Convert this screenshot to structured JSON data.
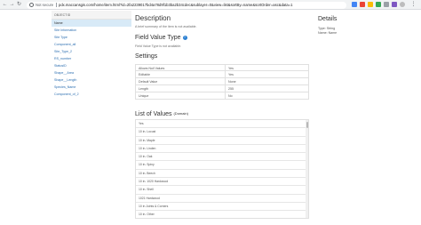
{
  "browser": {
    "security_label": "Not secure",
    "url": "pdx.maccansgis.com/home/item.html?id=2fa2239017bd4a78d9f1b3ba2b34cdec&sublayer=0&view=list&sortBy=name&sortOrder=asc&data=1"
  },
  "sidebar": {
    "header": "OBJECTID",
    "items": [
      {
        "label": "Name"
      },
      {
        "label": "Site Information"
      },
      {
        "label": "Site Type"
      },
      {
        "label": "Component_all"
      },
      {
        "label": "Site_Type_2"
      },
      {
        "label": "RS_number"
      },
      {
        "label": "StatusID"
      },
      {
        "label": "Shape__Area"
      },
      {
        "label": "Shape__Length"
      },
      {
        "label": "Species_Name"
      },
      {
        "label": "Component_of_2"
      }
    ]
  },
  "main": {
    "description_heading": "Description",
    "description_text": "A brief summary of the item is not available.",
    "field_value_type_heading": "Field Value Type",
    "field_value_type_text": "Field Value Type is not available.",
    "settings_heading": "Settings",
    "settings": [
      {
        "label": "Allows Null Values",
        "value": "Yes"
      },
      {
        "label": "Editable",
        "value": "Yes"
      },
      {
        "label": "Default Value",
        "value": "None"
      },
      {
        "label": "Length",
        "value": "255"
      },
      {
        "label": "Unique",
        "value": "No"
      }
    ],
    "lov_heading": "List of Values",
    "lov_subheading": "(Domain)",
    "lov_items": [
      "Yes",
      "10 in. Locust",
      "10 in. Maple",
      "10 in. Linden",
      "10 in. Oak",
      "10 in. Spiny",
      "10 in. Beech",
      "10 in. 1020 Hardwood",
      "10 in. Shell",
      "1021 Hardwood",
      "10 in Joints & Corners",
      "10 in. Other"
    ]
  },
  "details": {
    "heading": "Details",
    "type_line": "Type: String",
    "name_line": "Name: Name"
  },
  "colors": {
    "link": "#2a6db0",
    "active_row": "#d8eaf7",
    "help_icon": "#2a7fd2"
  },
  "icons": {
    "help": "question-circle",
    "info": "info-circle"
  }
}
